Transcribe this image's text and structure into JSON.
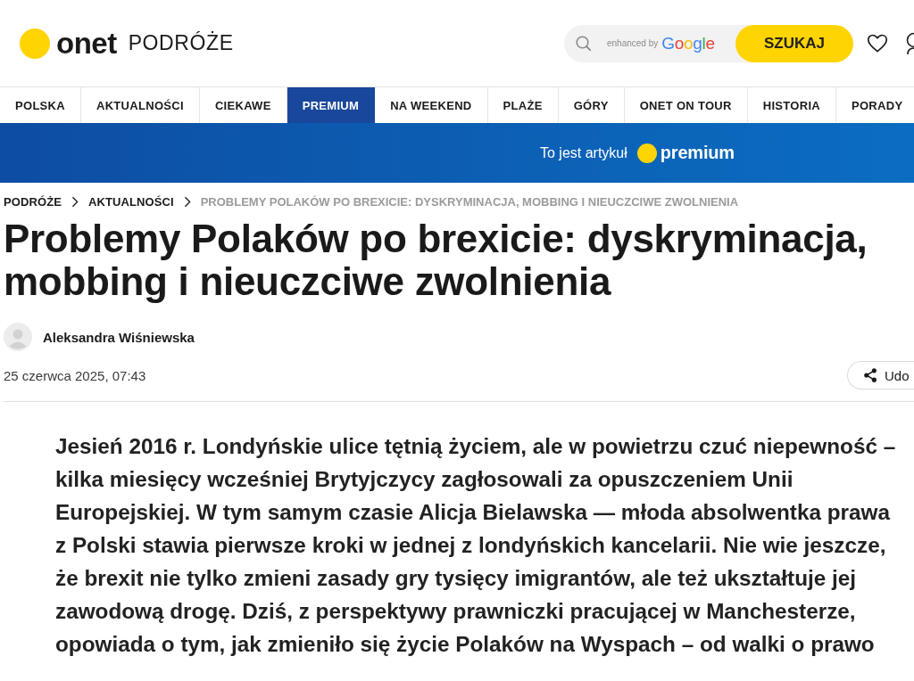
{
  "header": {
    "logo": "onet",
    "section": "PODRÓŻE",
    "search": {
      "badge_prefix": "enhanced by",
      "badge": "Google",
      "button": "SZUKAJ"
    }
  },
  "nav": {
    "items": [
      {
        "label": "POLSKA",
        "selected": false
      },
      {
        "label": "AKTUALNOŚCI",
        "selected": false
      },
      {
        "label": "CIEKAWE",
        "selected": false
      },
      {
        "label": "PREMIUM",
        "selected": true
      },
      {
        "label": "NA WEEKEND",
        "selected": false
      },
      {
        "label": "PLAŻE",
        "selected": false
      },
      {
        "label": "GÓRY",
        "selected": false
      },
      {
        "label": "ONET ON TOUR",
        "selected": false
      },
      {
        "label": "HISTORIA",
        "selected": false
      },
      {
        "label": "PORADY",
        "selected": false
      }
    ]
  },
  "banner": {
    "text": "To jest artykuł",
    "badge": "premium"
  },
  "breadcrumb": [
    {
      "label": "PODRÓŻE",
      "current": false
    },
    {
      "label": "AKTUALNOŚCI",
      "current": false
    },
    {
      "label": "PROBLEMY POLAKÓW PO BREXICIE: DYSKRYMINACJA, MOBBING I NIEUCZCIWE ZWOLNIENIA",
      "current": true
    }
  ],
  "article": {
    "title": "Problemy Polaków po brexicie: dyskryminacja, mobbing i nieuczciwe zwolnienia",
    "author": "Aleksandra Wiśniewska",
    "date": "25 czerwca 2025, 07:43",
    "share_button": "Udo",
    "lead": [
      "Jesień 2016 r. Londyńskie ulice tętnią życiem, ale w powietrzu czuć niepewność –",
      "kilka miesięcy wcześniej Brytyjczycy zagłosowali za opuszczeniem Unii",
      "Europejskiej. W tym samym czasie Alicja Bielawska — młoda absolwentka prawa",
      "z Polski stawia pierwsze kroki w jednej z londyńskich kancelarii. Nie wie jeszcze,",
      "że brexit nie tylko zmieni zasady gry tysięcy imigrantów, ale też ukształtuje jej",
      "zawodową drogę. Dziś, z perspektywy prawniczki pracującej w Manchesterze,",
      "opowiada o tym, jak zmieniło się życie Polaków na Wyspach – od walki o prawo"
    ]
  }
}
